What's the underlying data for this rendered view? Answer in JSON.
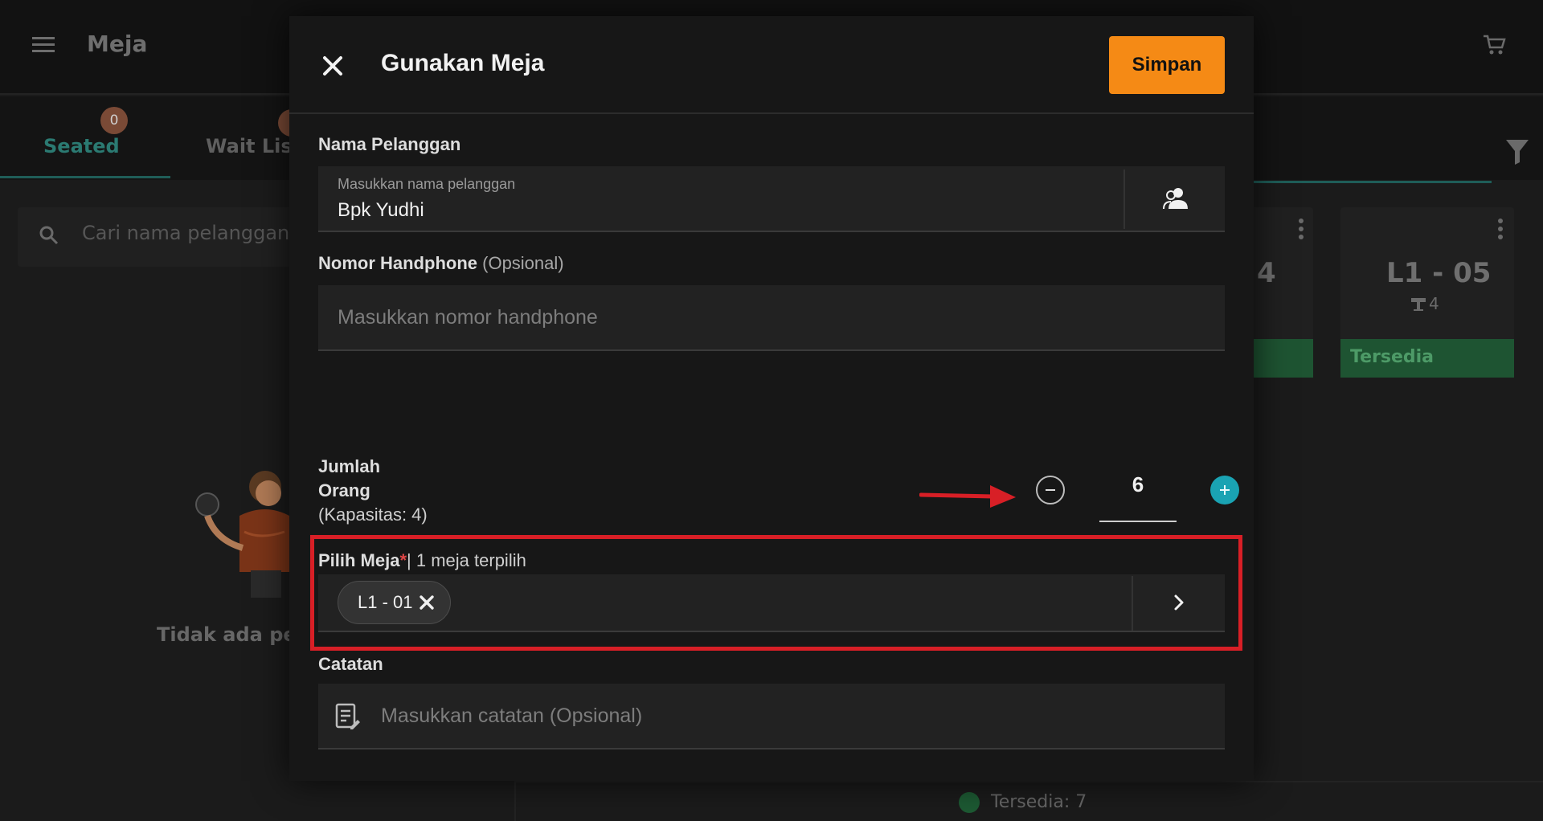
{
  "background": {
    "title": "Meja",
    "tabs": [
      {
        "label": "Seated",
        "count": "0"
      },
      {
        "label": "Wait List",
        "count": "0"
      }
    ],
    "search_placeholder": "Cari nama pelanggan",
    "empty_text": "Tidak ada pel",
    "tables": [
      {
        "name": "4",
        "status": ""
      },
      {
        "name": "L1 - 05",
        "capacity": "4",
        "status": "Tersedia"
      }
    ],
    "legend": "Tersedia: 7"
  },
  "modal": {
    "title": "Gunakan Meja",
    "save_label": "Simpan",
    "customer": {
      "label": "Nama Pelanggan",
      "float_label": "Masukkan nama pelanggan",
      "value": "Bpk Yudhi"
    },
    "phone": {
      "label": "Nomor Handphone",
      "optional": "(Opsional)",
      "placeholder": "Masukkan nomor handphone",
      "value": ""
    },
    "people": {
      "label_line1": "Jumlah",
      "label_line2": "Orang",
      "capacity_text": "(Kapasitas: 4)",
      "value": "6"
    },
    "table_select": {
      "label": "Pilih Meja",
      "required_mark": "*",
      "selected_text": "| 1 meja terpilih",
      "chips": [
        "L1 - 01"
      ]
    },
    "notes": {
      "label": "Catatan",
      "placeholder": "Masukkan catatan (Opsional)"
    }
  },
  "colors": {
    "accent_orange": "#f58a15",
    "accent_teal": "#1aa3b3",
    "annotation_red": "#d81f26",
    "available_green": "#1e5432"
  }
}
